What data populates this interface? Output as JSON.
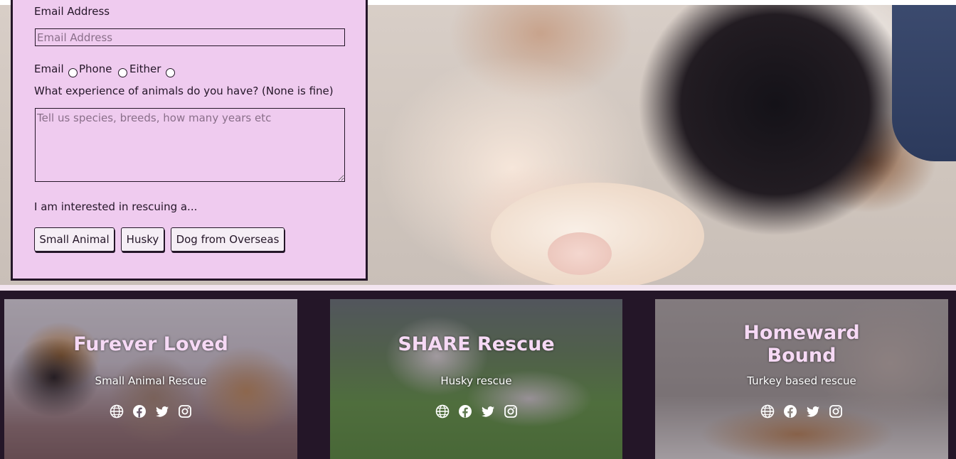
{
  "form": {
    "email_label": "Email Address",
    "email_placeholder": "Email Address",
    "contact_options": [
      "Email",
      "Phone",
      "Either"
    ],
    "experience_label": "What experience of animals do you have? (None is fine)",
    "experience_placeholder": "Tell us species, breeds, how many years etc",
    "interest_label": "I am interested in rescuing a...",
    "buttons": [
      "Small Animal",
      "Husky",
      "Dog from Overseas"
    ]
  },
  "cards": [
    {
      "title": "Furever Loved",
      "subtitle": "Small Animal Rescue"
    },
    {
      "title": "SHARE Rescue",
      "subtitle": "Husky rescue"
    },
    {
      "title_line1": "Homeward",
      "title_line2": "Bound",
      "subtitle": "Turkey based rescue"
    }
  ],
  "social_icons": [
    "globe-icon",
    "facebook-icon",
    "twitter-icon",
    "instagram-icon"
  ],
  "colors": {
    "form_bg": "#efcbef",
    "dark": "#241628",
    "title": "#f6d9f5"
  }
}
